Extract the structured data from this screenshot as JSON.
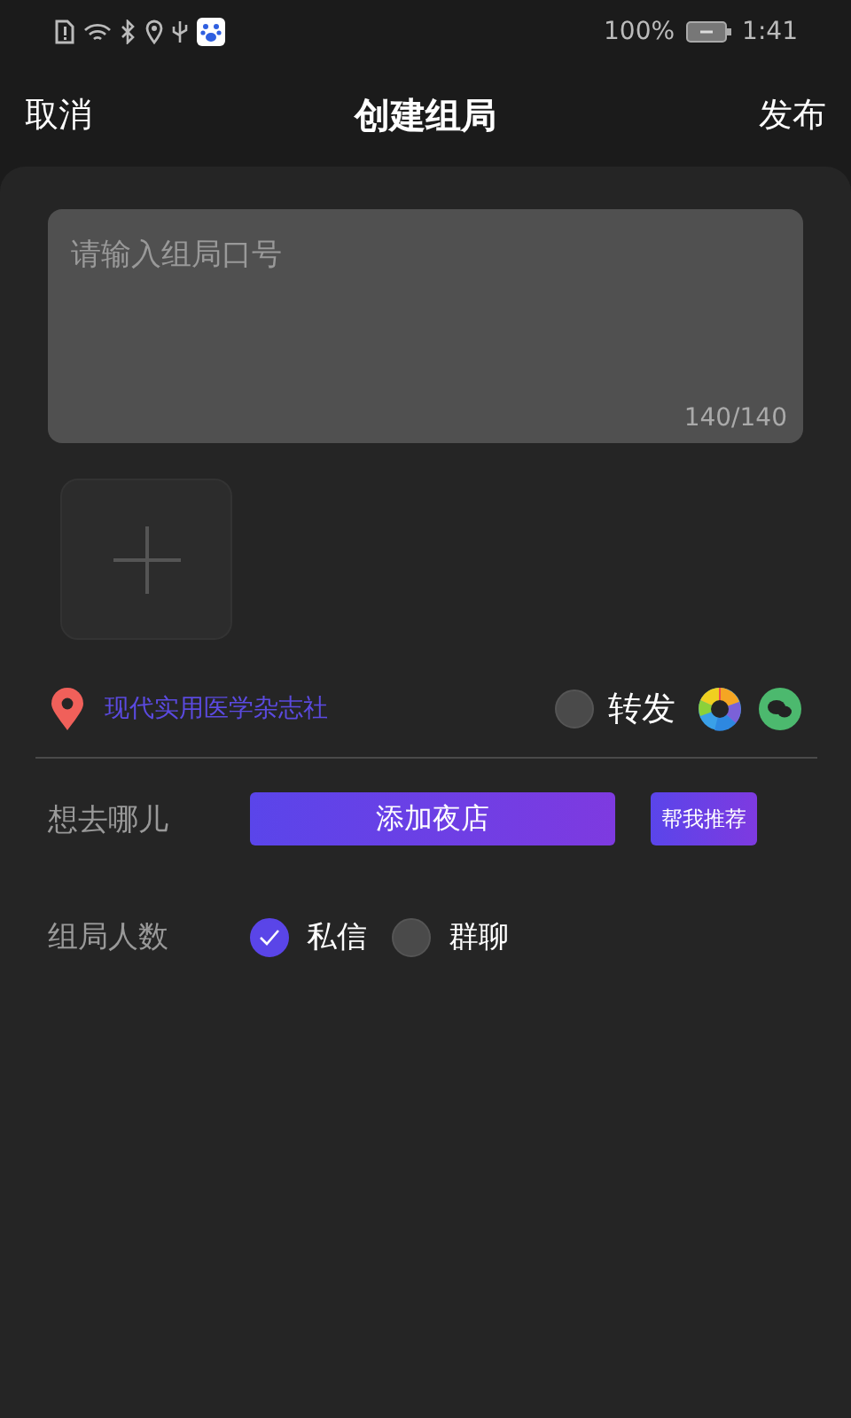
{
  "status_bar": {
    "battery": "100%",
    "time": "1:41"
  },
  "header": {
    "cancel": "取消",
    "title": "创建组局",
    "publish": "发布"
  },
  "slogan": {
    "placeholder": "请输入组局口号",
    "counter": "140/140"
  },
  "location": {
    "name": "现代实用医学杂志社"
  },
  "forward": {
    "label": "转发",
    "checked": false
  },
  "destination": {
    "label": "想去哪儿",
    "add_button": "添加夜店",
    "recommend_button": "帮我推荐"
  },
  "party_size": {
    "label": "组局人数",
    "options": [
      {
        "label": "私信",
        "selected": true
      },
      {
        "label": "群聊",
        "selected": false
      }
    ]
  }
}
